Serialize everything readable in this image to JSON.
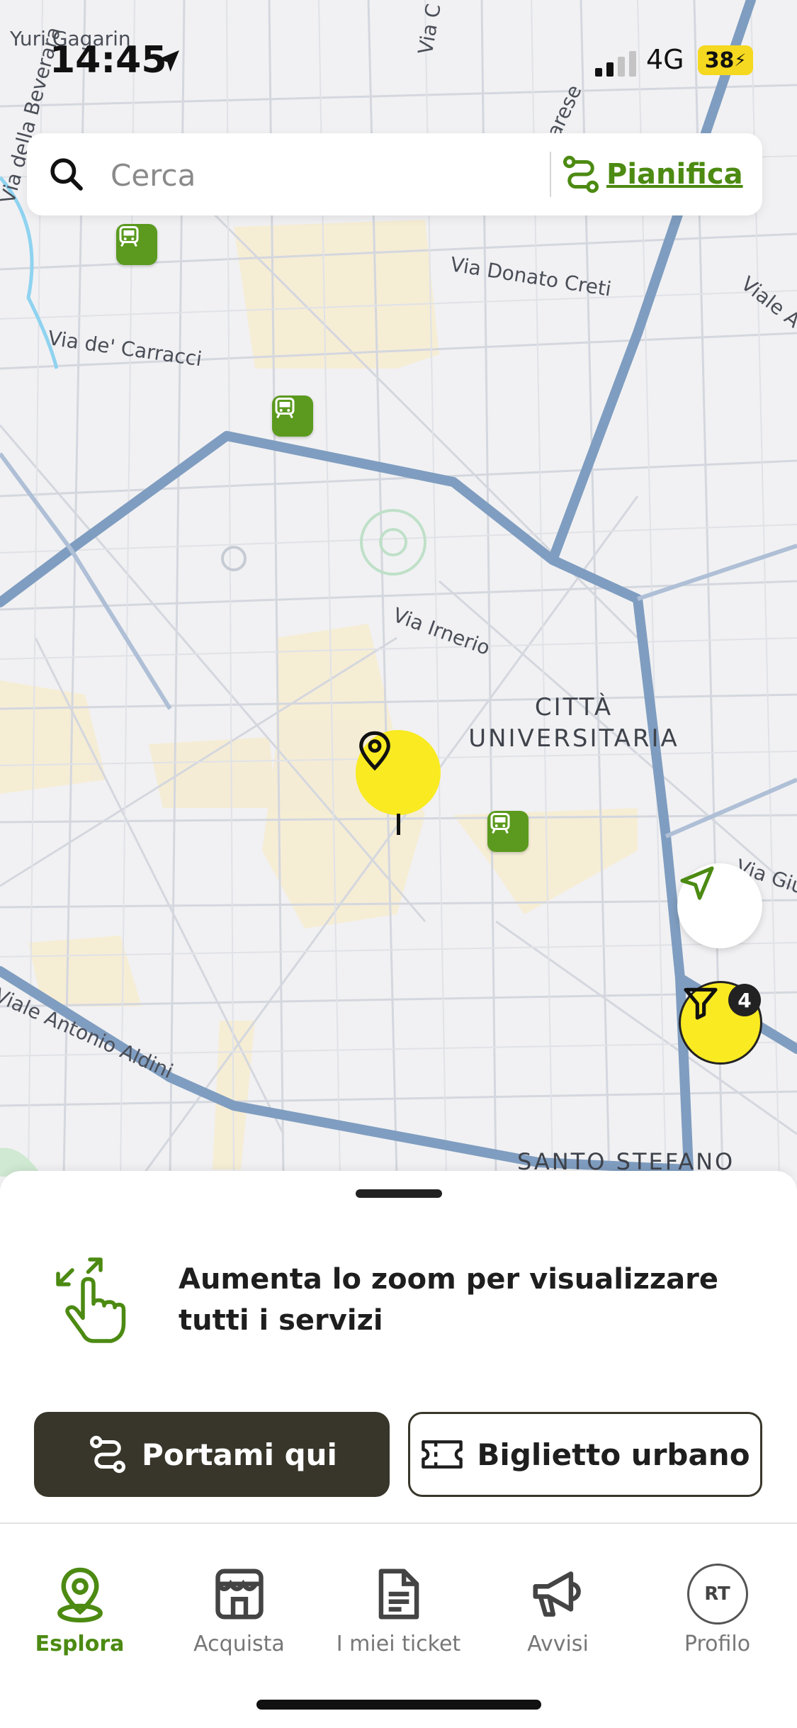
{
  "status_bar": {
    "time": "14:45",
    "network": "4G",
    "battery": "38"
  },
  "search": {
    "placeholder": "Cerca",
    "plan_label": "Pianifica"
  },
  "map": {
    "street_labels": [
      "Yuri Gagarin",
      "Via della Beverara",
      "Via Donato Creti",
      "Via de' Carracci",
      "Via Irnerio",
      "Viale Antonio Aldini",
      "Viale A",
      "Via Gius",
      "Via C",
      "arese"
    ],
    "district_label_line1": "CITTÀ",
    "district_label_line2": "UNIVERSITARIA",
    "bottom_label": "SANTO STEFANO",
    "filter_count": "4"
  },
  "sheet": {
    "zoom_message": "Aumenta lo zoom per visualizzare tutti i servizi",
    "primary_button": "Portami qui",
    "secondary_button": "Biglietto urbano"
  },
  "tabs": [
    {
      "label": "Esplora",
      "icon": "map-pin-icon",
      "active": true
    },
    {
      "label": "Acquista",
      "icon": "store-icon",
      "active": false
    },
    {
      "label": "I miei ticket",
      "icon": "document-icon",
      "active": false
    },
    {
      "label": "Avvisi",
      "icon": "megaphone-icon",
      "active": false
    },
    {
      "label": "Profilo",
      "icon": "avatar",
      "active": false
    }
  ],
  "profile_initials": "RT",
  "colors": {
    "accent_green": "#4c8a12",
    "pin_yellow": "#f9ea22",
    "dark_button": "#38362a",
    "road_blue": "#7f9dc0"
  }
}
